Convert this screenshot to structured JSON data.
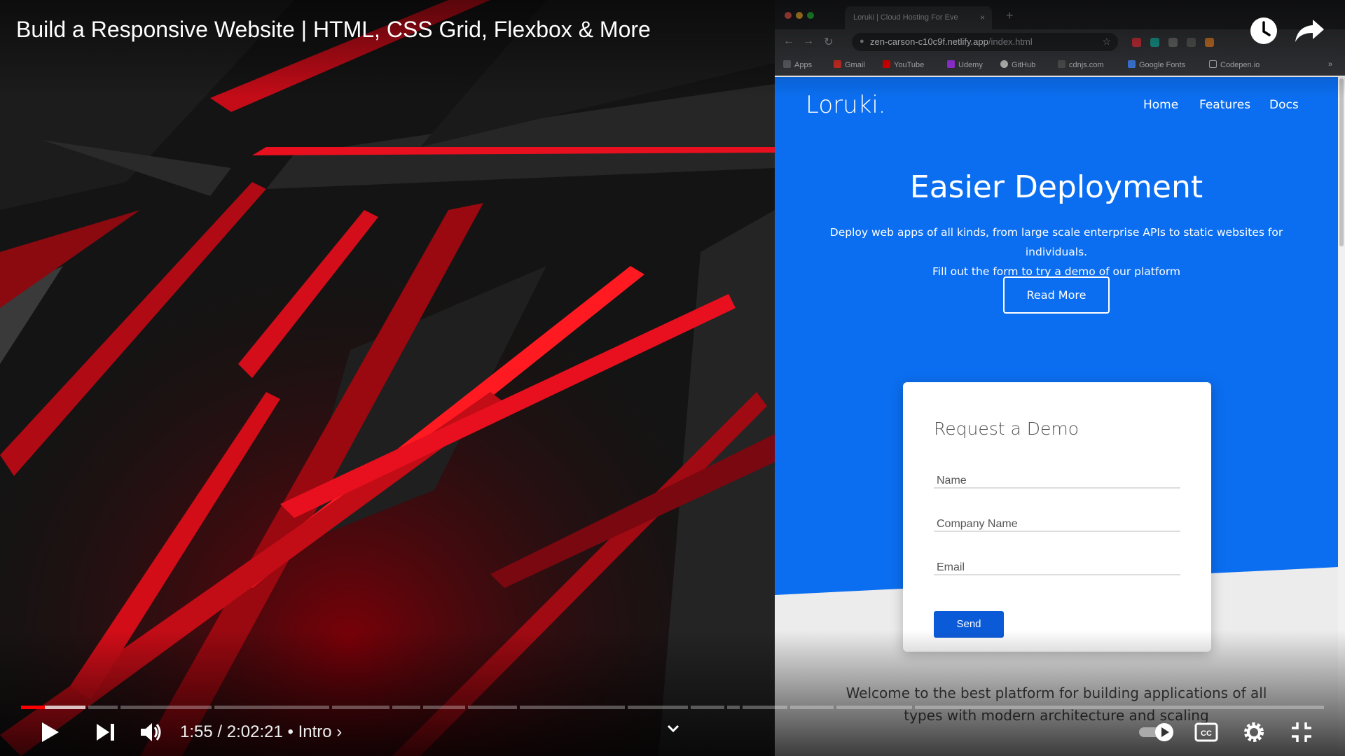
{
  "video": {
    "title": "Build a Responsive Website | HTML, CSS Grid, Flexbox & More",
    "current_time": "1:55",
    "duration": "2:02:21",
    "chapter": "Intro",
    "chapter_prefix": "•",
    "chapter_arrow": "›",
    "progress_fraction": 0.016,
    "icons": [
      "watch-later-icon",
      "share-icon",
      "play-icon",
      "next-icon",
      "volume-icon",
      "chevron-down-icon",
      "autoplay-toggle-icon",
      "captions-icon",
      "settings-icon",
      "exit-fullscreen-icon"
    ]
  },
  "browser": {
    "tab_title": "Loruki | Cloud Hosting For Eve",
    "tab_close": "×",
    "new_tab": "+",
    "url_main": "zen-carson-c10c9f.netlify.app",
    "url_path": "/index.html",
    "bookmarks": [
      "Apps",
      "Gmail",
      "YouTube",
      "Udemy",
      "GitHub",
      "cdnjs.com",
      "Google Fonts",
      "Codepen.io"
    ],
    "bookmarks_more": "»"
  },
  "site": {
    "logo": "Loruki.",
    "nav": [
      "Home",
      "Features",
      "Docs"
    ],
    "hero_title": "Easier Deployment",
    "hero_text_line1": "Deploy web apps of all kinds, from large scale enterprise APIs to static websites for individuals.",
    "hero_text_line2": "Fill out the form to try a demo of our platform",
    "read_more": "Read More",
    "form": {
      "title": "Request a Demo",
      "fields": [
        "Name",
        "Company Name",
        "Email"
      ],
      "submit": "Send"
    },
    "welcome_line1": "Welcome to the best platform for building applications of all",
    "welcome_line2": "types with modern architecture and scaling",
    "colors": {
      "hero_blue": "#0b6ef0",
      "button_blue": "#0b5bd8"
    }
  },
  "colors": {
    "progress_red": "#ff0000",
    "accent_red": "#e8101e"
  }
}
